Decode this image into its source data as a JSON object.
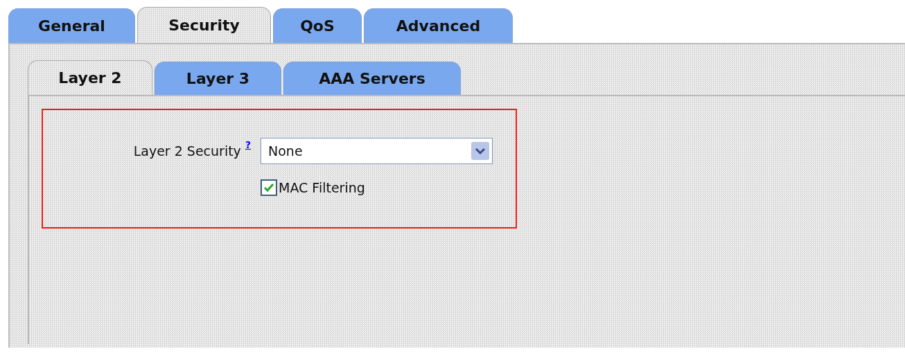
{
  "tabs": [
    {
      "label": "General",
      "selected": false
    },
    {
      "label": "Security",
      "selected": true
    },
    {
      "label": "QoS",
      "selected": false
    },
    {
      "label": "Advanced",
      "selected": false
    }
  ],
  "sub_tabs": [
    {
      "label": "Layer 2",
      "selected": true
    },
    {
      "label": "Layer 3",
      "selected": false
    },
    {
      "label": "AAA Servers",
      "selected": false
    }
  ],
  "form": {
    "label": "Layer 2 Security",
    "help_link": "?",
    "select_value": "None",
    "checkbox": {
      "label": "MAC Filtering",
      "checked": true
    }
  }
}
